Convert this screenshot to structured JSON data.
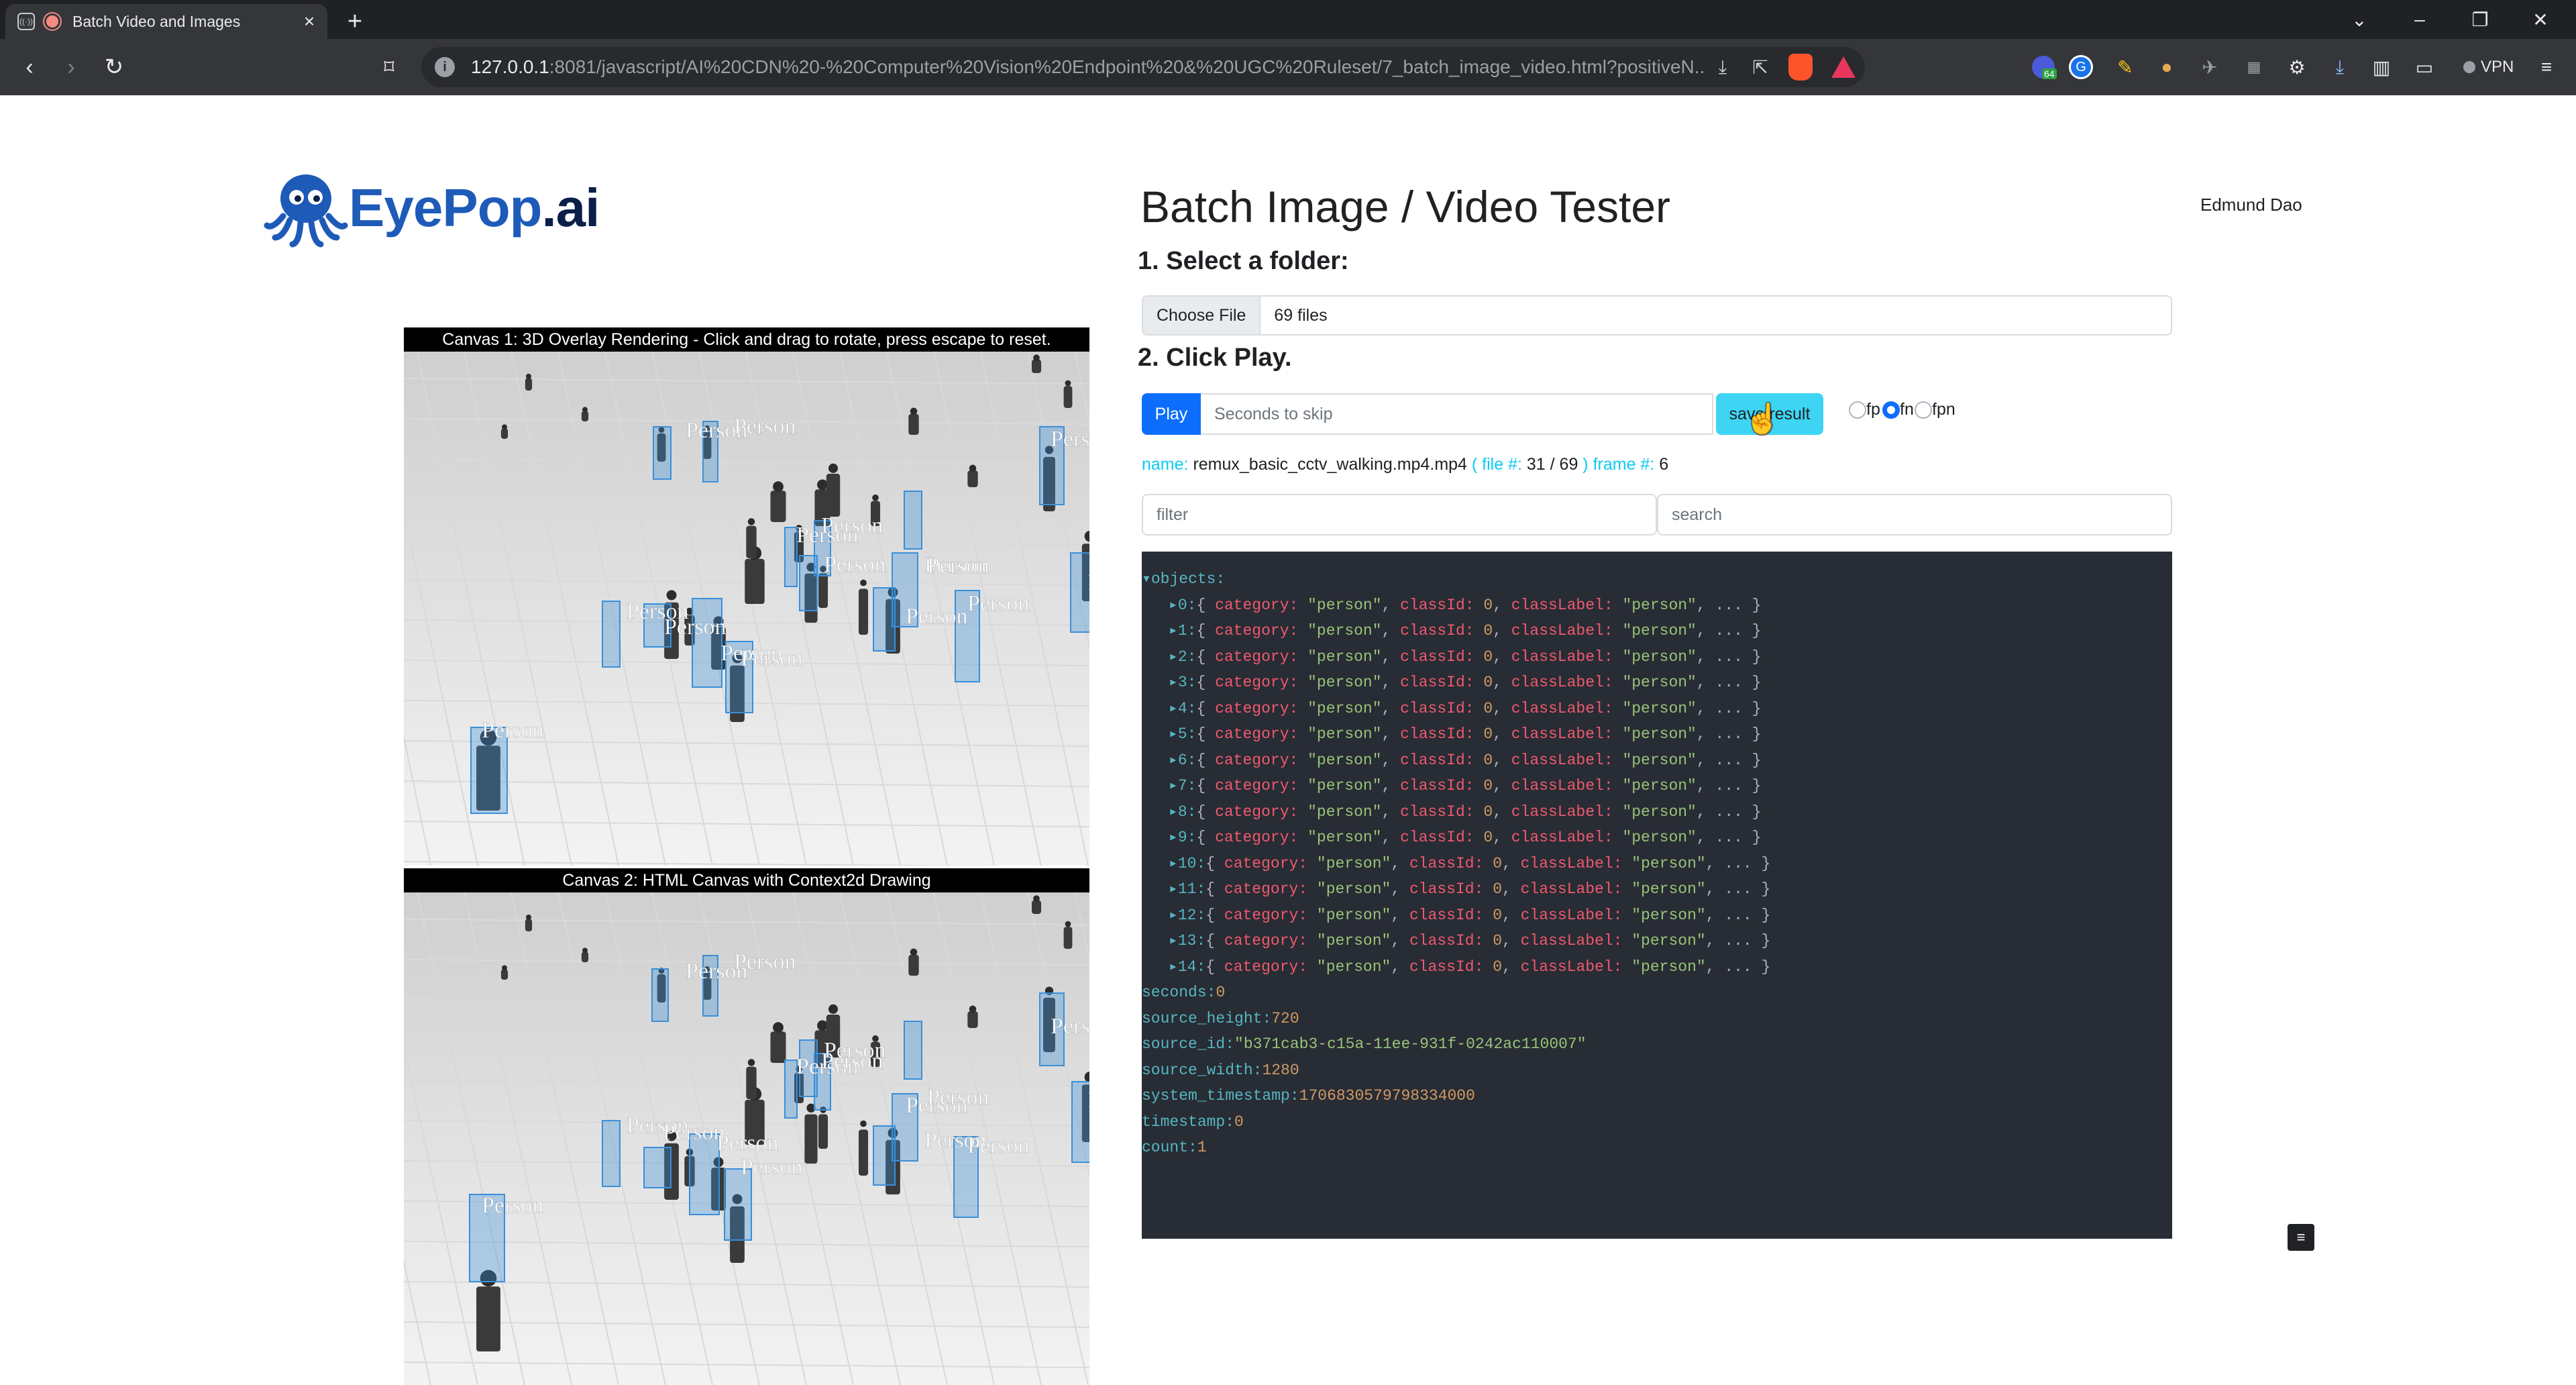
{
  "browser": {
    "tab_title": "Batch Video and Images",
    "new_tab": "+",
    "url_host": "127.0.0.1",
    "url_path": ":8081/javascript/AI%20CDN%20-%20Computer%20Vision%20Endpoint%20&%20UGC%20Ruleset/7_batch_image_video.html?positiveN...",
    "vpn_label": "VPN",
    "ext_badge": "64"
  },
  "header": {
    "logo_eye": "EyePop",
    "logo_ai": ".ai",
    "page_title": "Batch Image / Video Tester",
    "user_name": "Edmund Dao"
  },
  "step1": {
    "label": "1. Select a folder:",
    "choose_label": "Choose File",
    "file_count": "69 files"
  },
  "step2": {
    "label": "2. Click Play.",
    "play_label": "Play",
    "skip_placeholder": "Seconds to skip",
    "save_label": "save result",
    "radio_options": [
      "fp",
      "fn",
      "fpn"
    ],
    "selected_radio": "fn"
  },
  "status": {
    "name_key": "name:",
    "name_value": "remux_basic_cctv_walking.mp4.mp4",
    "file_key": "( file #:",
    "file_value": "31 / 69",
    "frame_key": ") frame #:",
    "frame_value": "6"
  },
  "filter_placeholder": "filter",
  "search_placeholder": "search",
  "json_view": {
    "objects_key": "objects:",
    "object_summary": {
      "category": "\"person\"",
      "classId": "0",
      "classLabel": "\"person\""
    },
    "object_count": 15,
    "fields": [
      {
        "key": "seconds",
        "value": "0",
        "type": "num"
      },
      {
        "key": "source_height",
        "value": "720",
        "type": "num"
      },
      {
        "key": "source_id",
        "value": "\"b371cab3-c15a-11ee-931f-0242ac110007\"",
        "type": "str"
      },
      {
        "key": "source_width",
        "value": "1280",
        "type": "num"
      },
      {
        "key": "system_timestamp",
        "value": "1706830579798334000",
        "type": "num"
      },
      {
        "key": "timestamp",
        "value": "0",
        "type": "num"
      },
      {
        "key": "count",
        "value": "1",
        "type": "num"
      }
    ]
  },
  "canvas1": {
    "caption": "Canvas 1: 3D Overlay Rendering - Click and drag to rotate, press escape to reset."
  },
  "canvas2": {
    "caption": "Canvas 2: HTML Canvas with Context2d Drawing"
  },
  "detection_label": "Person",
  "fab_icon": "≡",
  "colors": {
    "accent": "#0d6efd",
    "save": "#3dd5f3",
    "json_bg": "#282c34",
    "box": "#3a8fd9"
  }
}
